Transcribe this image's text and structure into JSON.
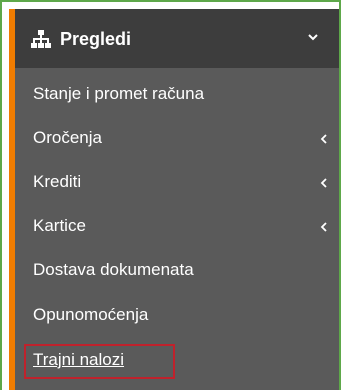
{
  "colors": {
    "frame_border": "#5ea84a",
    "panel_bg": "#3d3d3d",
    "submenu_bg": "#5a5a5a",
    "accent": "#f07c00",
    "highlight_border": "#c0222c",
    "text": "#ffffff"
  },
  "menu": {
    "header": {
      "icon": "sitemap-icon",
      "label": "Pregledi",
      "chevron": "chevron-down-icon"
    },
    "items": [
      {
        "label": "Stanje i promet računa",
        "has_submenu": false
      },
      {
        "label": "Oročenja",
        "has_submenu": true,
        "arrow": "chevron-left-icon"
      },
      {
        "label": "Krediti",
        "has_submenu": true,
        "arrow": "chevron-left-icon"
      },
      {
        "label": "Kartice",
        "has_submenu": true,
        "arrow": "chevron-left-icon"
      },
      {
        "label": "Dostava dokumenata",
        "has_submenu": false
      },
      {
        "label": "Opunomoćenja",
        "has_submenu": false
      },
      {
        "label": "Trajni nalozi",
        "has_submenu": false,
        "highlighted": true
      }
    ]
  }
}
